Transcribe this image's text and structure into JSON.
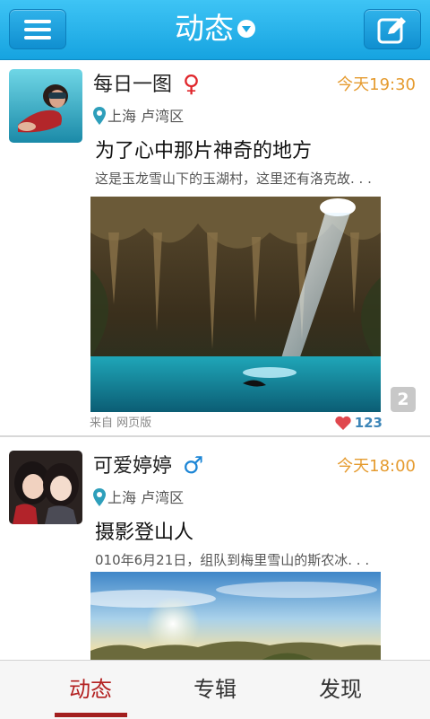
{
  "header": {
    "title": "动态",
    "menu_icon": "hamburger-icon",
    "compose_icon": "edit-icon",
    "accent": "#1aa6e1"
  },
  "feed": [
    {
      "user": "每日一图",
      "gender": "♀",
      "time": "今天19:30",
      "location": "上海 卢湾区",
      "title": "为了心中那片神奇的地方",
      "excerpt": "这是玉龙雪山下的玉湖村，这里还有洛克故. . .",
      "photo_count": "2",
      "source": "来自  网页版",
      "likes": "123"
    },
    {
      "user": "可爱婷婷",
      "gender": "♂",
      "time": "今天18:00",
      "location": "上海 卢湾区",
      "title": "摄影登山人",
      "excerpt": "010年6月21日，组队到梅里雪山的斯农冰. . ."
    }
  ],
  "nav": {
    "tabs": [
      {
        "label": "动态",
        "active": true
      },
      {
        "label": "专辑",
        "active": false
      },
      {
        "label": "发现",
        "active": false
      }
    ],
    "active_color": "#b32020"
  }
}
